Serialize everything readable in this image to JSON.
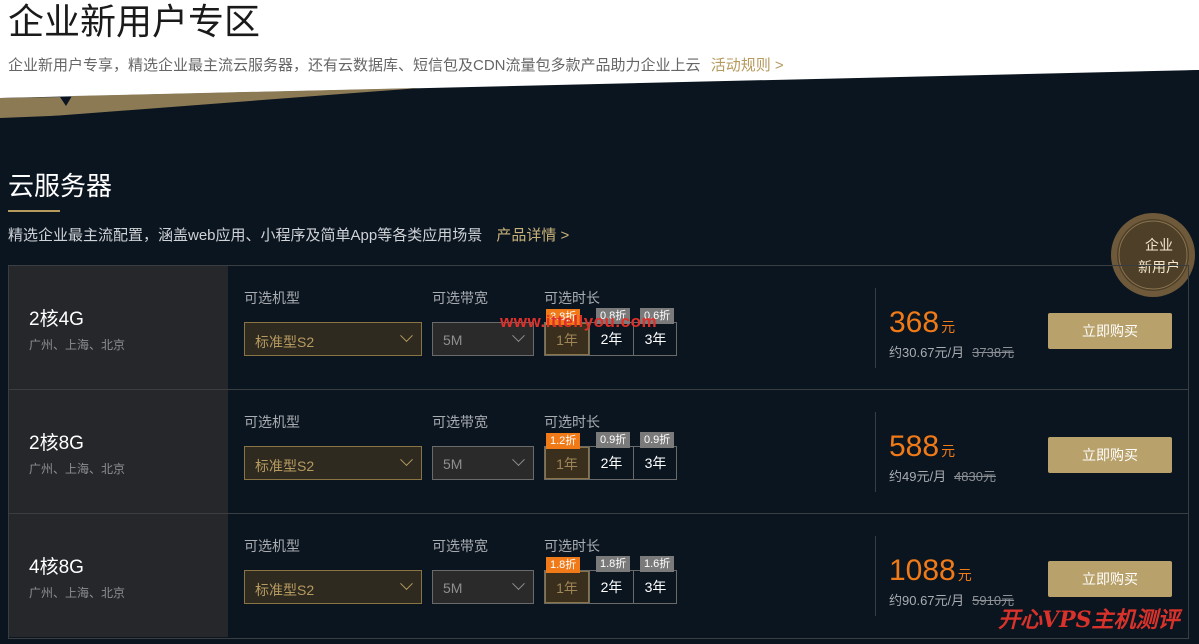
{
  "header": {
    "title": "企业新用户专区",
    "subtitle": "企业新用户专享，精选企业最主流云服务器，还有云数据库、短信包及CDN流量包多款产品助力企业上云",
    "rules_link": "活动规则 >"
  },
  "section": {
    "title": "云服务器",
    "desc": "精选企业最主流配置，涵盖web应用、小程序及简单App等各类应用场景",
    "details_link": "产品详情 >",
    "badge_line1": "企业",
    "badge_line2": "新用户"
  },
  "labels": {
    "model": "可选机型",
    "bandwidth": "可选带宽",
    "duration": "可选时长",
    "buy": "立即购买",
    "unit": "元"
  },
  "rows": [
    {
      "spec": "2核4G",
      "regions": "广州、上海、北京",
      "model": "标准型S2",
      "bandwidth": "5M",
      "durations": [
        {
          "label": "1年",
          "discount": "3.8折"
        },
        {
          "label": "2年",
          "discount": "0.8折"
        },
        {
          "label": "3年",
          "discount": "0.6折"
        }
      ],
      "price": "368",
      "monthly": "约30.67元/月",
      "original": "3738元"
    },
    {
      "spec": "2核8G",
      "regions": "广州、上海、北京",
      "model": "标准型S2",
      "bandwidth": "5M",
      "durations": [
        {
          "label": "1年",
          "discount": "1.2折"
        },
        {
          "label": "2年",
          "discount": "0.9折"
        },
        {
          "label": "3年",
          "discount": "0.9折"
        }
      ],
      "price": "588",
      "monthly": "约49元/月",
      "original": "4830元"
    },
    {
      "spec": "4核8G",
      "regions": "广州、上海、北京",
      "model": "标准型S2",
      "bandwidth": "5M",
      "durations": [
        {
          "label": "1年",
          "discount": "1.8折"
        },
        {
          "label": "2年",
          "discount": "1.8折"
        },
        {
          "label": "3年",
          "discount": "1.6折"
        }
      ],
      "price": "1088",
      "monthly": "约90.67元/月",
      "original": "5910元"
    }
  ],
  "watermarks": {
    "site": "www.ittellyou.com",
    "brand": "开心VPS主机测评"
  },
  "colors": {
    "accent_gold": "#b59a5c",
    "price_orange": "#f07a18",
    "background": "#0b1520"
  }
}
